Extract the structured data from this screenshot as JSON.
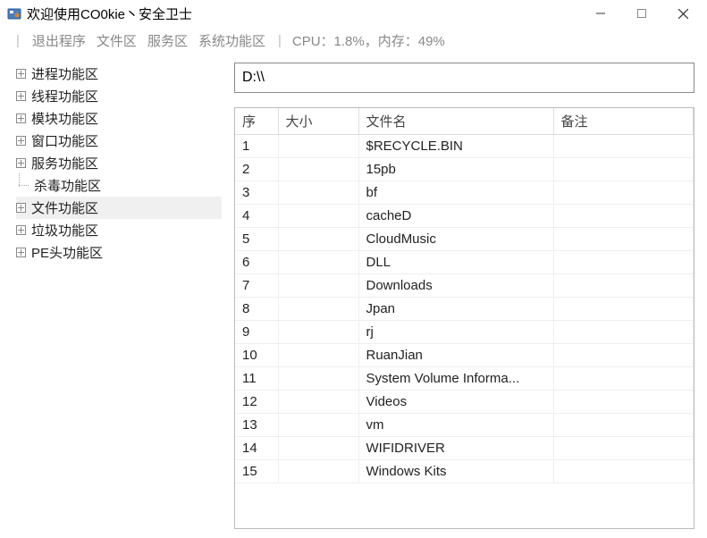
{
  "window": {
    "title": "欢迎使用CO0kie丶安全卫士"
  },
  "menu": {
    "exit": "退出程序",
    "file_area": "文件区",
    "service_area": "服务区",
    "system_area": "系统功能区",
    "stats": "CPU：1.8%，内存：49%"
  },
  "sidebar": {
    "items": [
      {
        "label": "进程功能区",
        "icon": "plus"
      },
      {
        "label": "线程功能区",
        "icon": "plus"
      },
      {
        "label": "模块功能区",
        "icon": "plus"
      },
      {
        "label": "窗口功能区",
        "icon": "plus"
      },
      {
        "label": "服务功能区",
        "icon": "plus"
      },
      {
        "label": "杀毒功能区",
        "icon": "branch"
      },
      {
        "label": "文件功能区",
        "icon": "plus",
        "selected": true
      },
      {
        "label": "垃圾功能区",
        "icon": "plus"
      },
      {
        "label": "PE头功能区",
        "icon": "plus"
      }
    ]
  },
  "path": {
    "value": "D:\\\\"
  },
  "table": {
    "headers": {
      "seq": "序",
      "size": "大小",
      "name": "文件名",
      "note": "备注"
    },
    "rows": [
      {
        "seq": "1",
        "size": "",
        "name": "$RECYCLE.BIN",
        "note": ""
      },
      {
        "seq": "2",
        "size": "",
        "name": "15pb",
        "note": ""
      },
      {
        "seq": "3",
        "size": "",
        "name": "bf",
        "note": ""
      },
      {
        "seq": "4",
        "size": "",
        "name": "cacheD",
        "note": ""
      },
      {
        "seq": "5",
        "size": "",
        "name": "CloudMusic",
        "note": ""
      },
      {
        "seq": "6",
        "size": "",
        "name": "DLL",
        "note": ""
      },
      {
        "seq": "7",
        "size": "",
        "name": "Downloads",
        "note": ""
      },
      {
        "seq": "8",
        "size": "",
        "name": "Jpan",
        "note": ""
      },
      {
        "seq": "9",
        "size": "",
        "name": "rj",
        "note": ""
      },
      {
        "seq": "10",
        "size": "",
        "name": "RuanJian",
        "note": ""
      },
      {
        "seq": "11",
        "size": "",
        "name": "System Volume Informa...",
        "note": ""
      },
      {
        "seq": "12",
        "size": "",
        "name": "Videos",
        "note": ""
      },
      {
        "seq": "13",
        "size": "",
        "name": "vm",
        "note": ""
      },
      {
        "seq": "14",
        "size": "",
        "name": "WIFIDRIVER",
        "note": ""
      },
      {
        "seq": "15",
        "size": "",
        "name": "Windows Kits",
        "note": ""
      }
    ]
  }
}
